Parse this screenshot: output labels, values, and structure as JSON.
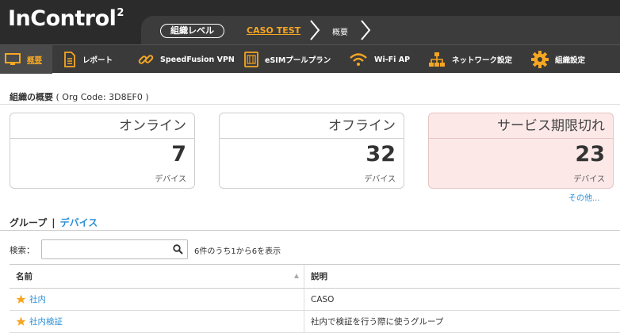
{
  "app": {
    "logo_text": "InControl",
    "logo_sup": "2"
  },
  "breadcrumb": {
    "level": "組織レベル",
    "org": "CASO TEST",
    "page": "概要"
  },
  "nav": {
    "items": [
      {
        "label": "概要",
        "icon": "monitor-icon",
        "active": true
      },
      {
        "label": "レポート",
        "icon": "document-icon"
      },
      {
        "label": "SpeedFusion VPN",
        "icon": "link-icon"
      },
      {
        "label": "eSIMプールプラン",
        "icon": "sim-card-icon"
      },
      {
        "label": "Wi-Fi AP",
        "icon": "wifi-icon"
      },
      {
        "label": "ネットワーク設定",
        "icon": "network-icon"
      },
      {
        "label": "組織設定",
        "icon": "gear-icon"
      }
    ]
  },
  "org_overview": {
    "title": "組織の概要",
    "code_text": "( Org Code: 3D8EF0 )"
  },
  "cards": [
    {
      "title": "オンライン",
      "count": "7",
      "unit": "デバイス"
    },
    {
      "title": "オフライン",
      "count": "32",
      "unit": "デバイス"
    },
    {
      "title": "サービス期限切れ",
      "count": "23",
      "unit": "デバイス"
    }
  ],
  "more_link": "その他...",
  "tabs": {
    "group": "グループ",
    "separator": "|",
    "devices": "デバイス"
  },
  "search": {
    "label": "検索：",
    "value": "",
    "placeholder": "",
    "result_text": "6件のうち1から6を表示"
  },
  "table": {
    "columns": [
      "名前",
      "説明"
    ],
    "rows": [
      {
        "name": "社内",
        "description": "CASO"
      },
      {
        "name": "社内検証",
        "description": "社内で検証を行う際に使うグループ"
      }
    ]
  },
  "colors": {
    "header_bg": "#2b2b2b",
    "accent": "#f5a623",
    "link": "#2a8fd6",
    "alert_card_bg": "#fde8e8"
  }
}
